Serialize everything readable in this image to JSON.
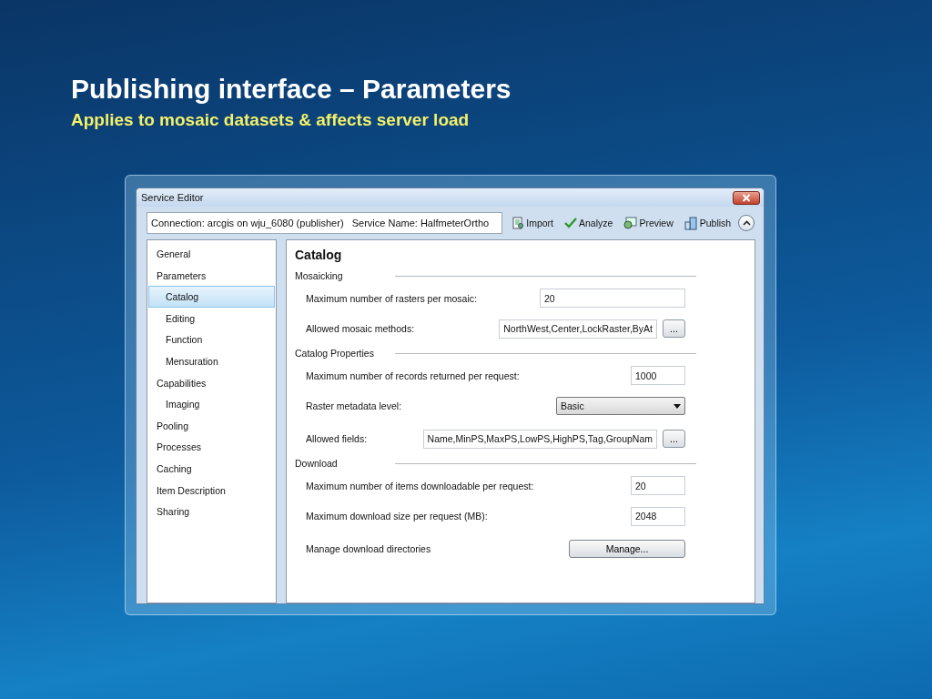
{
  "slide": {
    "title": "Publishing interface – Parameters",
    "subtitle": "Applies to mosaic datasets & affects server load"
  },
  "window": {
    "title": "Service Editor"
  },
  "connection_field": {
    "value": "Connection: arcgis on wju_6080 (publisher)   Service Name: HalfmeterOrtho"
  },
  "toolbar": [
    {
      "label": "Import"
    },
    {
      "label": "Analyze"
    },
    {
      "label": "Preview"
    },
    {
      "label": "Publish"
    }
  ],
  "sidebar": {
    "items": [
      {
        "label": "General",
        "selected": false
      },
      {
        "label": "Parameters",
        "selected": false,
        "children": [
          {
            "label": "Catalog",
            "selected": true
          },
          {
            "label": "Editing",
            "selected": false
          },
          {
            "label": "Function",
            "selected": false
          },
          {
            "label": "Mensuration",
            "selected": false
          }
        ]
      },
      {
        "label": "Capabilities",
        "selected": false,
        "children": [
          {
            "label": "Imaging",
            "selected": false
          }
        ]
      },
      {
        "label": "Pooling",
        "selected": false
      },
      {
        "label": "Processes",
        "selected": false
      },
      {
        "label": "Caching",
        "selected": false
      },
      {
        "label": "Item Description",
        "selected": false
      },
      {
        "label": "Sharing",
        "selected": false
      }
    ]
  },
  "panel": {
    "heading": "Catalog",
    "sections": [
      {
        "title": "Mosaicking",
        "rows": [
          {
            "kind": "wide",
            "label": "Maximum number of rasters per mosaic:",
            "value": "20"
          },
          {
            "kind": "browse",
            "label": "Allowed mosaic methods:",
            "value": "NorthWest,Center,LockRaster,ByAt",
            "button": "..."
          }
        ]
      },
      {
        "title": "Catalog Properties",
        "rows": [
          {
            "kind": "short",
            "label": "Maximum number of records returned per request:",
            "value": "1000"
          },
          {
            "kind": "select",
            "label": "Raster metadata level:",
            "value": "Basic"
          },
          {
            "kind": "browse",
            "label": "Allowed fields:",
            "value": "Name,MinPS,MaxPS,LowPS,HighPS,Tag,GroupNam",
            "button": "..."
          }
        ]
      },
      {
        "title": "Download",
        "rows": [
          {
            "kind": "short",
            "label": "Maximum number of items downloadable per request:",
            "value": "20"
          },
          {
            "kind": "short",
            "label": "Maximum download size per request (MB):",
            "value": "2048"
          },
          {
            "kind": "action",
            "label": "Manage download directories",
            "button": "Manage..."
          }
        ]
      }
    ]
  }
}
